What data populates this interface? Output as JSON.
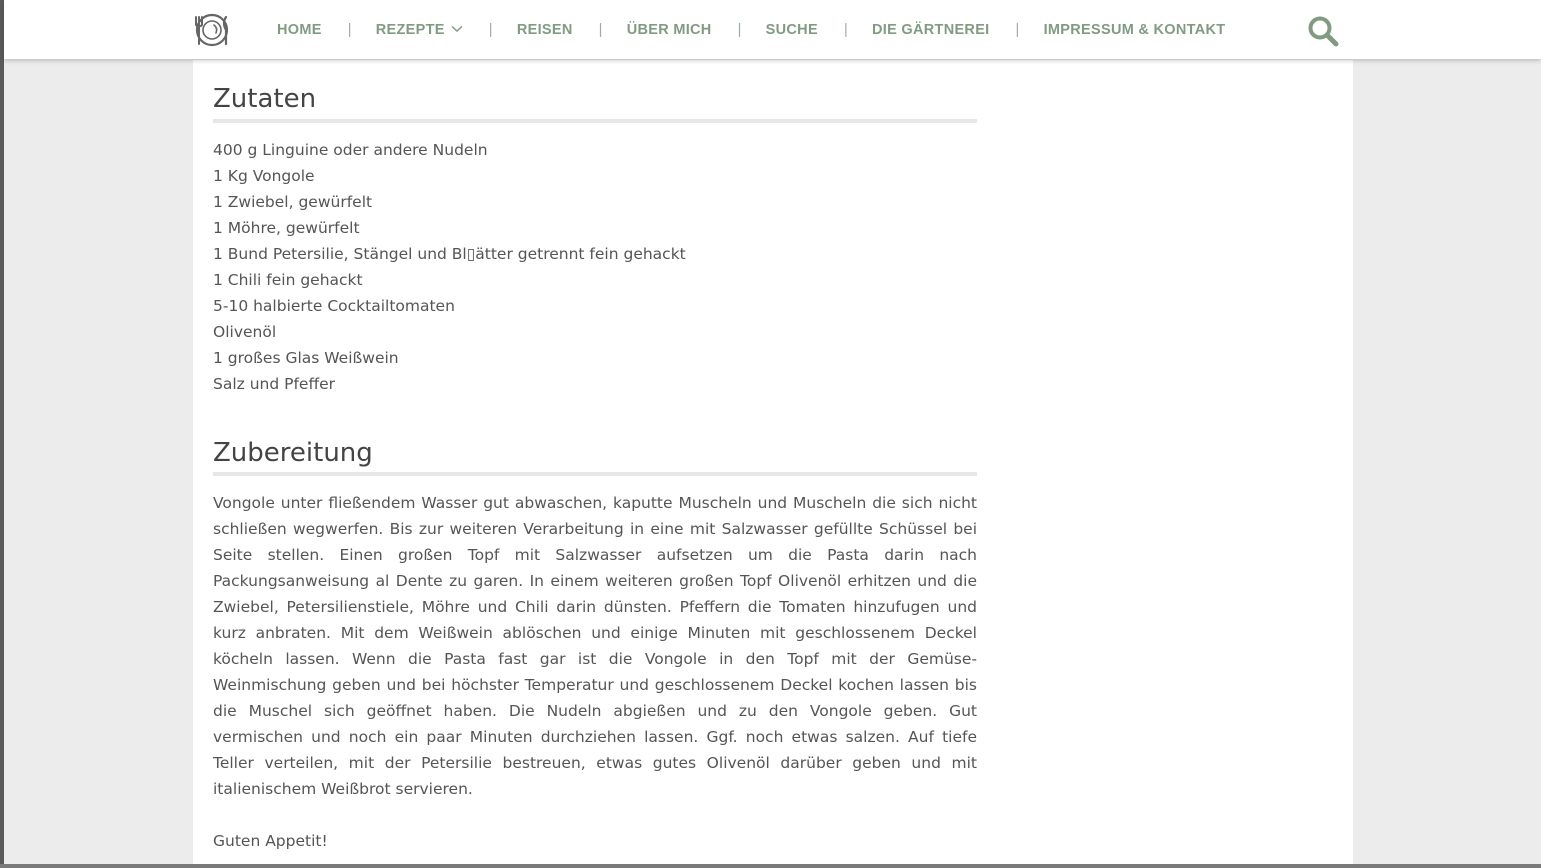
{
  "nav": {
    "items": [
      {
        "label": "HOME"
      },
      {
        "label": "REZEPTE",
        "has_dropdown": true
      },
      {
        "label": "REISEN"
      },
      {
        "label": "ÜBER MICH"
      },
      {
        "label": "SUCHE"
      },
      {
        "label": "DIE GÄRTNEREI"
      },
      {
        "label": "IMPRESSUM & KONTAKT"
      }
    ],
    "separator": "|"
  },
  "icons": {
    "logo": "plate-cutlery-logo-icon",
    "search": "search-icon",
    "dropdown": "chevron-down-icon"
  },
  "colors": {
    "accent": "#7f9c80",
    "heading": "#444444",
    "body_text": "#555555",
    "rule": "#e7e7e7",
    "page_bg": "#ececec"
  },
  "ingredients": {
    "title": "Zutaten",
    "items": [
      "400 g Linguine oder andere Nudeln",
      "1 Kg Vongole",
      "1 Zwiebel, gewürfelt",
      "1 Möhre, gewürfelt",
      "1 Bund Petersilie, Stängel und Bl▯ätter getrennt fein gehackt",
      "1 Chili fein gehackt",
      "5-10 halbierte Cocktailtomaten",
      "Olivenöl",
      "1 großes Glas Weißwein",
      "Salz und Pfeffer"
    ]
  },
  "preparation": {
    "title": "Zubereitung",
    "text": "Vongole unter fließendem Wasser gut abwaschen, kaputte Muscheln und Muscheln die sich nicht schließen wegwerfen. Bis zur weiteren Verarbeitung in eine mit Salzwasser gefüllte Schüssel bei Seite stellen. Einen großen Topf mit Salzwasser aufsetzen um die Pasta darin nach Packungsanweisung al Dente zu garen. In einem weiteren großen Topf Olivenöl erhitzen und die Zwiebel, Petersilienstiele, Möhre und Chili darin dünsten. Pfeffern die Tomaten hinzufugen und kurz anbraten. Mit dem Weißwein ablöschen und einige Minuten mit geschlossenem Deckel köcheln lassen. Wenn die Pasta fast gar ist die Vongole in den Topf mit der Gemüse-Weinmischung geben und bei höchster Temperatur und geschlossenem Deckel kochen lassen bis die Muschel sich geöffnet haben. Die Nudeln abgießen und zu den Vongole geben. Gut vermischen und noch ein paar Minuten durchziehen lassen. Ggf. noch etwas salzen. Auf tiefe Teller verteilen, mit der Petersilie bestreuen, etwas gutes Olivenöl darüber geben und mit italienischem Weißbrot servieren.",
    "closing": "Guten Appetit!"
  }
}
